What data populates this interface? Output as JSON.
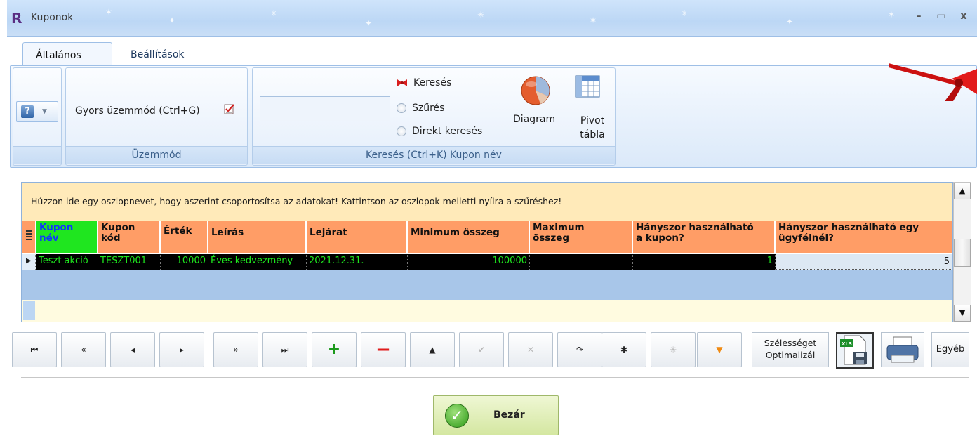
{
  "window": {
    "title": "Kuponok",
    "logo_letter": "R",
    "minimize": "–",
    "maximize": "▭",
    "close": "x"
  },
  "tabs": [
    {
      "label": "Általános",
      "active": true
    },
    {
      "label": "Beállítások",
      "active": false
    }
  ],
  "ribbon": {
    "help_icon": "?",
    "mode": {
      "quick_mode_label": "Gyors üzemmód (Ctrl+G)",
      "group_label": "Üzemmód"
    },
    "search": {
      "input_value": "",
      "options": [
        "Keresés",
        "Szűrés",
        "Direkt keresés"
      ],
      "selected_option": "Keresés",
      "group_label": "Keresés (Ctrl+K) Kupon név",
      "diagram_label": "Diagram",
      "pivot_label_1": "Pivot",
      "pivot_label_2": "tábla"
    }
  },
  "grid": {
    "group_panel_text": "Húzzon ide egy oszlopnevet, hogy aszerint csoportosítsa az adatokat! Kattintson az oszlopok melletti nyílra a szűréshez!",
    "columns": [
      {
        "l1": "Kupon",
        "l2": "név"
      },
      {
        "l1": "Kupon",
        "l2": "kód"
      },
      {
        "l1": "Érték",
        "l2": ""
      },
      {
        "l1": "Leírás",
        "l2": ""
      },
      {
        "l1": "Lejárat",
        "l2": ""
      },
      {
        "l1": "Minimum összeg",
        "l2": ""
      },
      {
        "l1": "Maximum",
        "l2": "összeg"
      },
      {
        "l1": "Hányszor használható",
        "l2": "a kupon?"
      },
      {
        "l1": "Hányszor használható egy",
        "l2": "ügyfélnél?"
      }
    ],
    "rows": [
      [
        "Teszt akció",
        "TESZT001",
        "10000",
        "Éves kedvezmény",
        "2021.12.31.",
        "100000",
        "",
        "1",
        "5"
      ]
    ]
  },
  "navigator": {
    "first": "⏮",
    "prev_page": "«",
    "prev": "◂",
    "next": "▸",
    "next_page": "»",
    "last": "⏭",
    "add": "+",
    "delete": "−",
    "edit": "▲",
    "post": "✔",
    "cancel": "✕",
    "refresh": "↷",
    "bookmark": "✱",
    "goto_bookmark": "✳",
    "filter": "▼",
    "optimize_l1": "Szélességet",
    "optimize_l2": "Optimalizál",
    "other": "Egyéb"
  },
  "footer": {
    "close_label": "Bezár"
  },
  "colors": {
    "header_bg": "#ff9d66",
    "selected_header_bg": "#1fe61f",
    "row_bg": "#000000",
    "row_text": "#1ee61e",
    "group_panel_bg": "#ffeab9"
  }
}
